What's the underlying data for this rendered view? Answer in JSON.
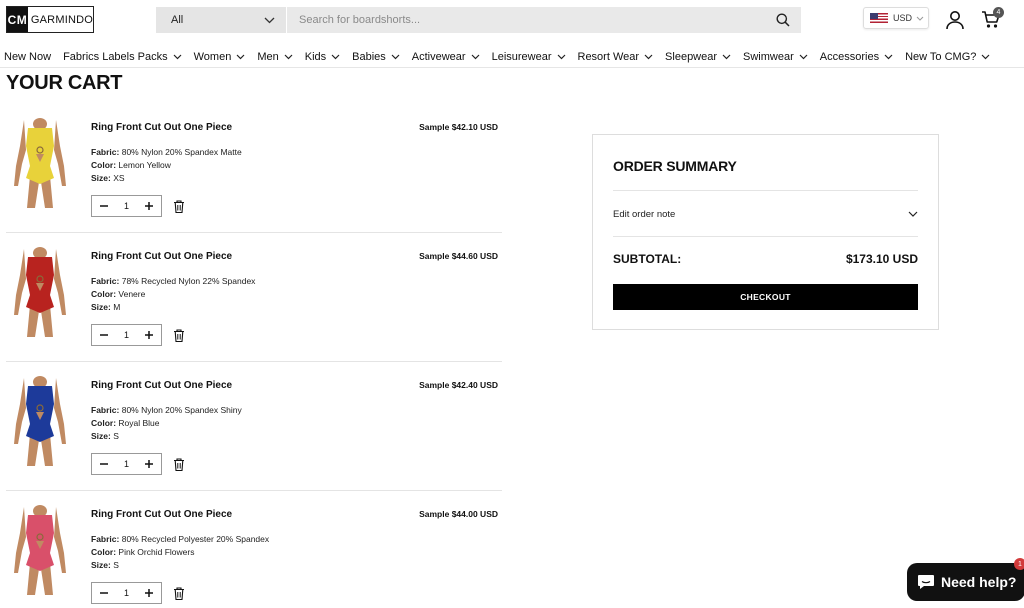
{
  "header": {
    "logo_mark": "CM",
    "logo_name": "GARMINDO",
    "search_category": "All",
    "search_placeholder": "Search for boardshorts...",
    "currency": "USD",
    "cart_count": "4"
  },
  "nav": {
    "items": [
      "New Now",
      "Fabrics Labels Packs",
      "Women",
      "Men",
      "Kids",
      "Babies",
      "Activewear",
      "Leisurewear",
      "Resort Wear",
      "Sleepwear",
      "Swimwear",
      "Accessories",
      "New To CMG?"
    ]
  },
  "page_title": "YOUR CART",
  "labels": {
    "fabric": "Fabric:",
    "color": "Color:",
    "size": "Size:"
  },
  "cart_items": [
    {
      "title": "Ring Front Cut Out One Piece",
      "price": "Sample $42.10 USD",
      "fabric": "80% Nylon 20% Spandex Matte",
      "color": "Lemon Yellow",
      "size": "XS",
      "qty": "1",
      "swatch": "#e8d23a"
    },
    {
      "title": "Ring Front Cut Out One Piece",
      "price": "Sample $44.60 USD",
      "fabric": "78% Recycled Nylon 22% Spandex",
      "color": "Venere",
      "size": "M",
      "qty": "1",
      "swatch": "#b8231f"
    },
    {
      "title": "Ring Front Cut Out One Piece",
      "price": "Sample $42.40 USD",
      "fabric": "80% Nylon 20% Spandex Shiny",
      "color": "Royal Blue",
      "size": "S",
      "qty": "1",
      "swatch": "#1d3a9a"
    },
    {
      "title": "Ring Front Cut Out One Piece",
      "price": "Sample $44.00 USD",
      "fabric": "80% Recycled Polyester 20% Spandex",
      "color": "Pink Orchid Flowers",
      "size": "S",
      "qty": "1",
      "swatch": "#d9506a"
    }
  ],
  "summary": {
    "title": "ORDER SUMMARY",
    "note_label": "Edit order note",
    "subtotal_label": "SUBTOTAL:",
    "subtotal_value": "$173.10 USD",
    "checkout_label": "CHECKOUT"
  },
  "help": {
    "label": "Need help?",
    "badge": "1"
  },
  "colors": {
    "accent": "#000000",
    "badge_red": "#d23b3b"
  }
}
